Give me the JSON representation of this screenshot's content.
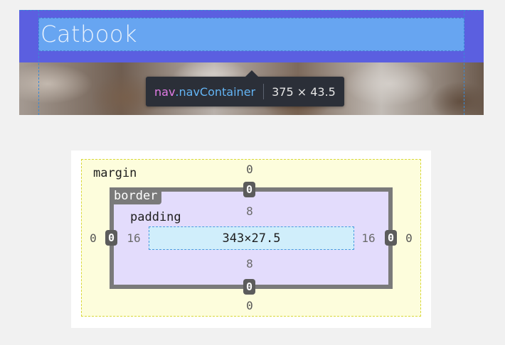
{
  "preview": {
    "nav_title": "Catbook",
    "tooltip": {
      "tag": "nav",
      "class_name": ".navContainer",
      "size": "375 × 43.5"
    },
    "colors": {
      "nav_highlight": "#5b5fe0",
      "content_highlight": "#67a5f1",
      "tooltip_bg": "#2b2f38",
      "tag_color": "#e27ce6",
      "class_color": "#63b4f4"
    }
  },
  "box_model": {
    "labels": {
      "margin": "margin",
      "border": "border",
      "padding": "padding"
    },
    "margin": {
      "top": "0",
      "right": "0",
      "bottom": "0",
      "left": "0"
    },
    "border": {
      "top": "0",
      "right": "0",
      "bottom": "0",
      "left": "0"
    },
    "padding": {
      "top": "8",
      "right": "16",
      "bottom": "8",
      "left": "16"
    },
    "content_size": "343×27.5",
    "colors": {
      "margin": "#fdfddc",
      "border": "#7a7a7a",
      "padding": "#e3dcfc",
      "content": "#d0eefb"
    }
  }
}
